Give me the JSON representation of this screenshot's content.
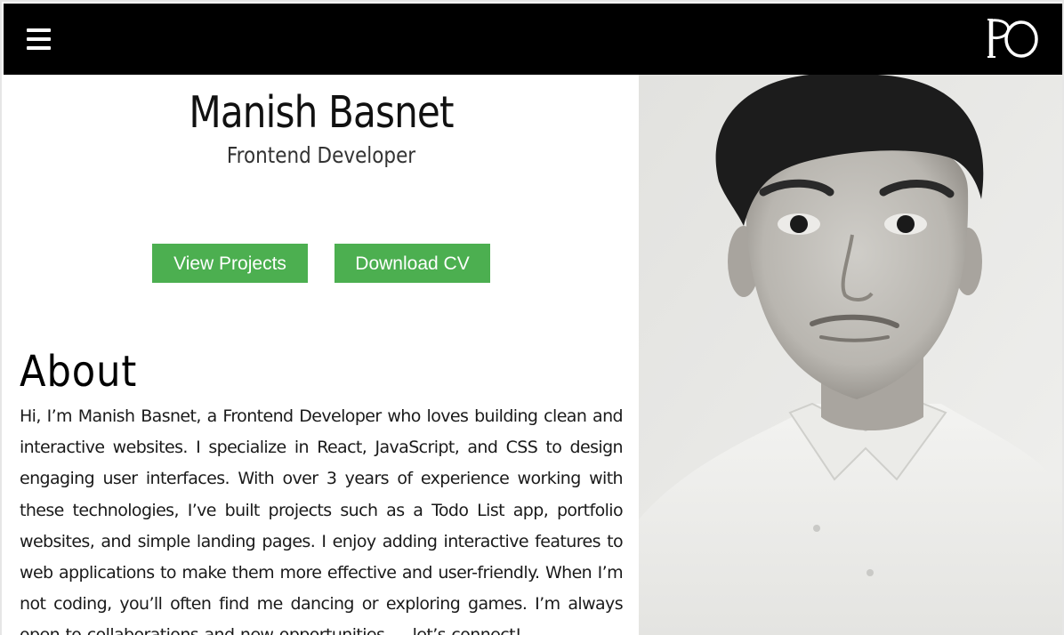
{
  "header": {
    "menu_icon": "hamburger-menu-icon",
    "logo_text": "PO",
    "background": "#000000"
  },
  "hero": {
    "name": "Manish Basnet",
    "role": "Frontend Developer",
    "buttons": {
      "view_projects": "View Projects",
      "download_cv": "Download CV"
    },
    "button_color": "#4caf50"
  },
  "about": {
    "heading": "About",
    "text": "Hi, I’m Manish Basnet, a Frontend Developer who loves building clean and interactive websites. I specialize in React, JavaScript, and CSS to design engaging user interfaces. With over 3 years of experience working with these technologies, I’ve built projects such as a Todo List app, portfolio websites, and simple landing pages. I enjoy adding interactive features to web applications to make them more effective and user-friendly. When I’m not coding, you’ll often find me dancing or exploring games. I’m always open to collaborations and new opportunities — let’s connect!"
  },
  "profile_photo": {
    "subject": "black-and-white portrait of a young man in a white polo shirt"
  }
}
